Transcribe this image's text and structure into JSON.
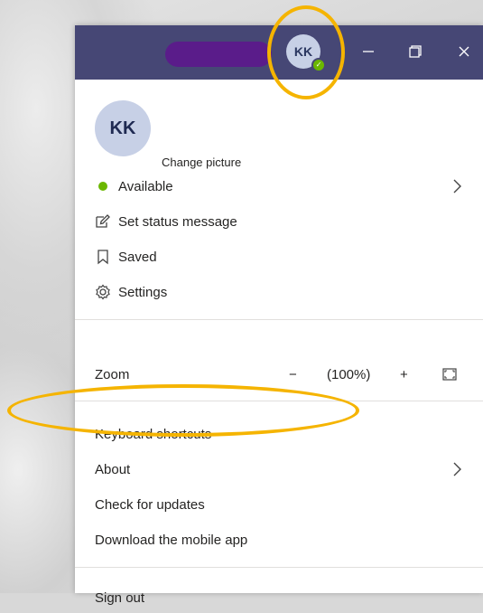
{
  "titlebar": {
    "avatar_initials": "KK",
    "presence": "available",
    "minimize_icon": "minimize-icon",
    "restore_icon": "restore-icon",
    "close_icon": "close-icon",
    "background": "#464775",
    "redaction_color": "#5a1c8a"
  },
  "profile": {
    "initials": "KK",
    "change_picture": "Change picture"
  },
  "status_items": [
    {
      "icon": "available-dot-icon",
      "label": "Available",
      "has_submenu": true
    },
    {
      "icon": "edit-status-icon",
      "label": "Set status message"
    },
    {
      "icon": "bookmark-icon",
      "label": "Saved"
    },
    {
      "icon": "gear-icon",
      "label": "Settings"
    }
  ],
  "zoom": {
    "label": "Zoom",
    "minus": "−",
    "value": "(100%)",
    "plus": "+",
    "fullscreen_icon": "fullscreen-icon"
  },
  "help_items": [
    {
      "label": "Keyboard shortcuts"
    },
    {
      "label": "About",
      "has_submenu": true
    },
    {
      "label": "Check for updates"
    },
    {
      "label": "Download the mobile app"
    }
  ],
  "sign_out": "Sign out",
  "colors": {
    "accent": "#464775",
    "presence_green": "#6bb700",
    "annotation": "#f5b400"
  }
}
